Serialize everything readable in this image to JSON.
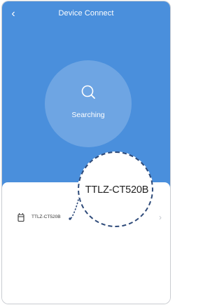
{
  "header": {
    "title": "Device Connect",
    "back_icon": "chevron-left-icon"
  },
  "search": {
    "status_label": "Searching",
    "icon": "search-icon"
  },
  "device_list": {
    "items": [
      {
        "name": "TTLZ-CT520B",
        "icon": "device-icon",
        "chevron": "›"
      }
    ]
  },
  "callout": {
    "zoom_label": "TTLZ-CT520B"
  },
  "colors": {
    "header_bg": "#4a8fdc",
    "accent": "#ffffff",
    "callout_border": "#2f4b7a"
  }
}
